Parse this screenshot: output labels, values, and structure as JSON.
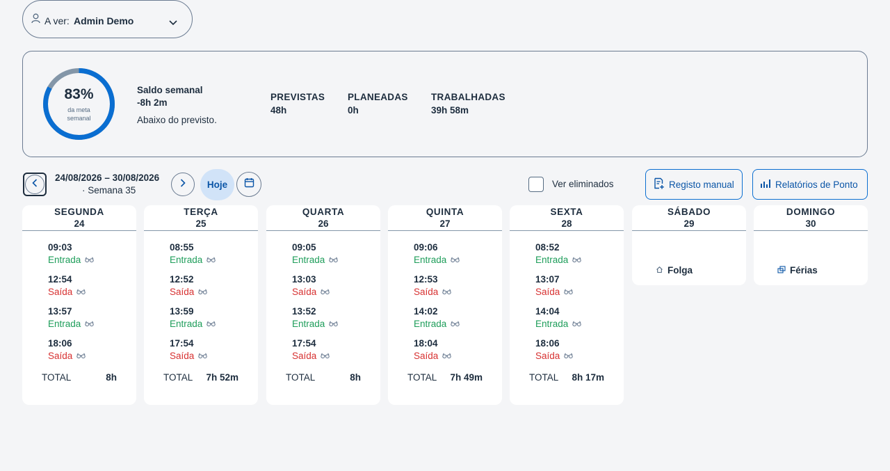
{
  "viewer": {
    "label": "A ver:",
    "value": "Admin Demo"
  },
  "summary": {
    "percent": "83%",
    "percent_value": 0.83,
    "percent_sub_1": "da meta",
    "percent_sub_2": "semanal",
    "saldo_title": "Saldo semanal",
    "saldo_value": "-8h 2m",
    "saldo_note": "Abaixo do previsto.",
    "stats": [
      {
        "label": "PREVISTAS",
        "value": "48h"
      },
      {
        "label": "PLANEADAS",
        "value": "0h"
      },
      {
        "label": "TRABALHADAS",
        "value": "39h 58m"
      }
    ]
  },
  "toolbar": {
    "range": "24/08/2026 – 30/08/2026",
    "week": "· Semana 35",
    "today": "Hoje",
    "show_deleted": "Ver eliminados",
    "manual_entry": "Registo manual",
    "reports": "Relatórios de Ponto"
  },
  "colors": {
    "accent": "#0a6ed1",
    "entrada": "#1e9d5a",
    "saida": "#d73131"
  },
  "days": [
    {
      "name": "SEGUNDA",
      "num": "24",
      "entries": [
        {
          "time": "09:03",
          "kind": "Entrada"
        },
        {
          "time": "12:54",
          "kind": "Saída"
        },
        {
          "time": "13:57",
          "kind": "Entrada"
        },
        {
          "time": "18:06",
          "kind": "Saída"
        }
      ],
      "total_label": "TOTAL",
      "total": "8h"
    },
    {
      "name": "TERÇA",
      "num": "25",
      "entries": [
        {
          "time": "08:55",
          "kind": "Entrada"
        },
        {
          "time": "12:52",
          "kind": "Saída"
        },
        {
          "time": "13:59",
          "kind": "Entrada"
        },
        {
          "time": "17:54",
          "kind": "Saída"
        }
      ],
      "total_label": "TOTAL",
      "total": "7h 52m"
    },
    {
      "name": "QUARTA",
      "num": "26",
      "entries": [
        {
          "time": "09:05",
          "kind": "Entrada"
        },
        {
          "time": "13:03",
          "kind": "Saída"
        },
        {
          "time": "13:52",
          "kind": "Entrada"
        },
        {
          "time": "17:54",
          "kind": "Saída"
        }
      ],
      "total_label": "TOTAL",
      "total": "8h"
    },
    {
      "name": "QUINTA",
      "num": "27",
      "entries": [
        {
          "time": "09:06",
          "kind": "Entrada"
        },
        {
          "time": "12:53",
          "kind": "Saída"
        },
        {
          "time": "14:02",
          "kind": "Entrada"
        },
        {
          "time": "18:04",
          "kind": "Saída"
        }
      ],
      "total_label": "TOTAL",
      "total": "7h 49m"
    },
    {
      "name": "SEXTA",
      "num": "28",
      "entries": [
        {
          "time": "08:52",
          "kind": "Entrada"
        },
        {
          "time": "13:07",
          "kind": "Saída"
        },
        {
          "time": "14:04",
          "kind": "Entrada"
        },
        {
          "time": "18:06",
          "kind": "Saída"
        }
      ],
      "total_label": "TOTAL",
      "total": "8h 17m"
    },
    {
      "name": "SÁBADO",
      "num": "29",
      "off": "Folga",
      "off_icon": "home-icon"
    },
    {
      "name": "DOMINGO",
      "num": "30",
      "off": "Férias",
      "off_icon": "vacation-icon"
    }
  ]
}
